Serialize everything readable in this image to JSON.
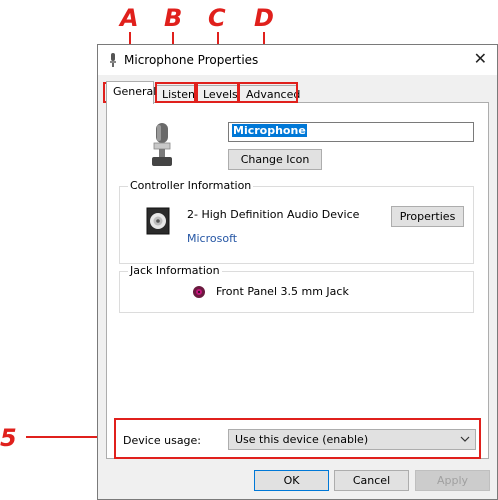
{
  "annotations": {
    "a": "A",
    "b": "B",
    "c": "C",
    "d": "D",
    "five": "5"
  },
  "window": {
    "title": "Microphone Properties",
    "close_glyph": "✕"
  },
  "tabs": [
    {
      "label": "General",
      "active": true
    },
    {
      "label": "Listen",
      "active": false
    },
    {
      "label": "Levels",
      "active": false
    },
    {
      "label": "Advanced",
      "active": false
    }
  ],
  "general": {
    "device_name": "Microphone",
    "change_icon_label": "Change Icon",
    "controller": {
      "group_label": "Controller Information",
      "device": "2- High Definition Audio Device",
      "manufacturer": "Microsoft",
      "properties_label": "Properties"
    },
    "jack": {
      "group_label": "Jack Information",
      "value": "Front Panel 3.5 mm Jack",
      "jack_color": "#c4157c"
    },
    "device_usage": {
      "label": "Device usage:",
      "selected": "Use this device (enable)"
    }
  },
  "buttons": {
    "ok": "OK",
    "cancel": "Cancel",
    "apply": "Apply"
  },
  "icons": {
    "title": "microphone-icon",
    "device": "microphone-icon",
    "controller": "speaker-icon",
    "jack": "jack-dot-icon",
    "dropdown": "chevron-down-icon"
  },
  "colors": {
    "annotation_red": "#e0201c",
    "selection_blue": "#0078d7",
    "link": "#2455a4"
  }
}
